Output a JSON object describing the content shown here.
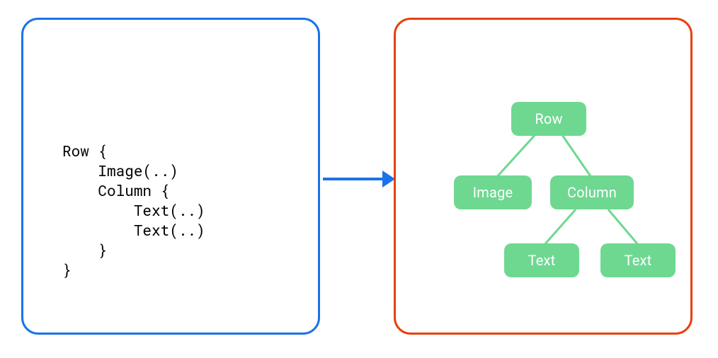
{
  "colors": {
    "left_border": "#1a73e8",
    "right_border": "#e8400c",
    "arrow": "#1a73e8",
    "node_fill": "#6ed891",
    "node_text": "#ffffff"
  },
  "code": {
    "lines": [
      "Row {",
      "    Image(..)",
      "    Column {",
      "        Text(..)",
      "        Text(..)",
      "    }",
      "}"
    ]
  },
  "tree": {
    "root": "Row",
    "level2_left": "Image",
    "level2_right": "Column",
    "level3_left": "Text",
    "level3_right": "Text"
  }
}
